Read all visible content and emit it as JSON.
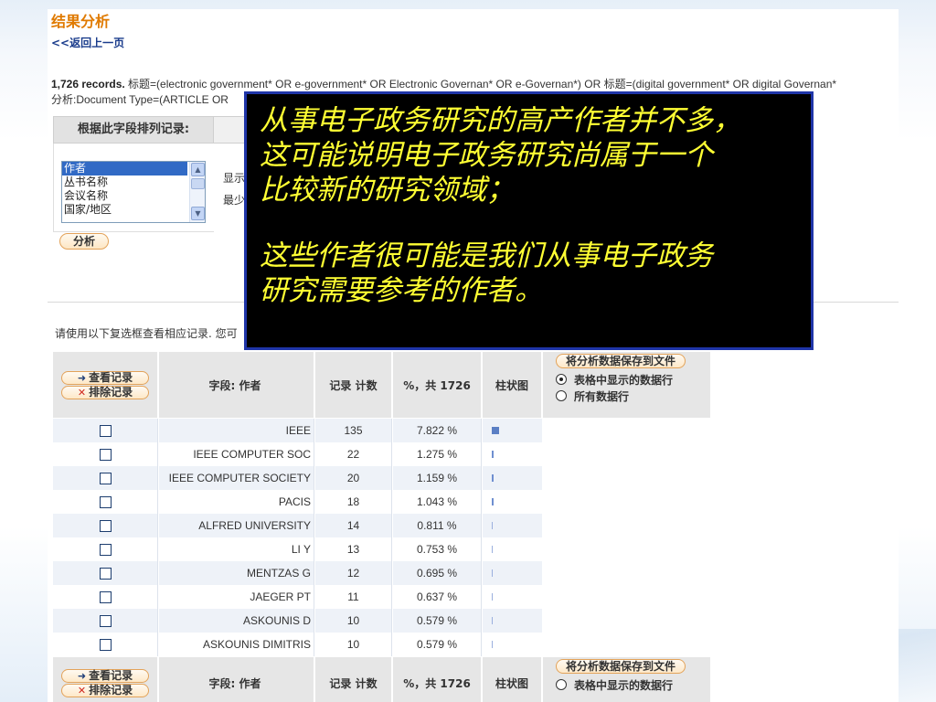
{
  "page": {
    "title": "结果分析",
    "back_link": "<<返回上一页",
    "query": {
      "count": "1,726 records.",
      "text": " 标题=(electronic government* OR e-government* OR Electronic Governan* OR e-Governan*) OR 标题=(digital government* OR digital Governan*",
      "line2": "分析:Document Type=(ARTICLE OR"
    }
  },
  "rank_panel": {
    "header": "根据此字段排列记录:",
    "options": [
      "作者",
      "丛书名称",
      "会议名称",
      "国家/地区"
    ],
    "selected_index": 0,
    "side_labels": [
      "显示",
      "最少"
    ],
    "analyze_button": "分析"
  },
  "instructions": "请使用以下复选框查看相应记录. 您可",
  "table": {
    "buttons": {
      "view": "查看记录",
      "exclude": "排除记录"
    },
    "headers": {
      "field": "字段: 作者",
      "count": "记录 计数",
      "percent": "%，共 1726",
      "bar": "柱状图"
    },
    "save": {
      "button": "将分析数据保存到文件",
      "option_visible": "表格中显示的数据行",
      "option_all": "所有数据行",
      "selected": "option_visible"
    },
    "rows": [
      {
        "name": "IEEE",
        "count": "135",
        "percent": "7.822 %",
        "pct": 7.822
      },
      {
        "name": "IEEE COMPUTER SOC",
        "count": "22",
        "percent": "1.275 %",
        "pct": 1.275
      },
      {
        "name": "IEEE COMPUTER SOCIETY",
        "count": "20",
        "percent": "1.159 %",
        "pct": 1.159
      },
      {
        "name": "PACIS",
        "count": "18",
        "percent": "1.043 %",
        "pct": 1.043
      },
      {
        "name": "ALFRED UNIVERSITY",
        "count": "14",
        "percent": "0.811 %",
        "pct": 0.811
      },
      {
        "name": "LI Y",
        "count": "13",
        "percent": "0.753 %",
        "pct": 0.753
      },
      {
        "name": "MENTZAS G",
        "count": "12",
        "percent": "0.695 %",
        "pct": 0.695
      },
      {
        "name": "JAEGER PT",
        "count": "11",
        "percent": "0.637 %",
        "pct": 0.637
      },
      {
        "name": "ASKOUNIS D",
        "count": "10",
        "percent": "0.579 %",
        "pct": 0.579
      },
      {
        "name": "ASKOUNIS DIMITRIS",
        "count": "10",
        "percent": "0.579 %",
        "pct": 0.579
      }
    ]
  },
  "overlay": {
    "para1": [
      "从事电子政务研究的高产作者并不多，",
      "这可能说明电子政务研究尚属于一个",
      "比较新的研究领域；"
    ],
    "para2": [
      "这些作者很可能是我们从事电子政务",
      "研究需要参考的作者。"
    ]
  },
  "colors": {
    "title_orange": "#e07a00",
    "overlay_text": "#ffff33",
    "overlay_border": "#1f35a8",
    "bar_blue": "#5b7fc4"
  }
}
